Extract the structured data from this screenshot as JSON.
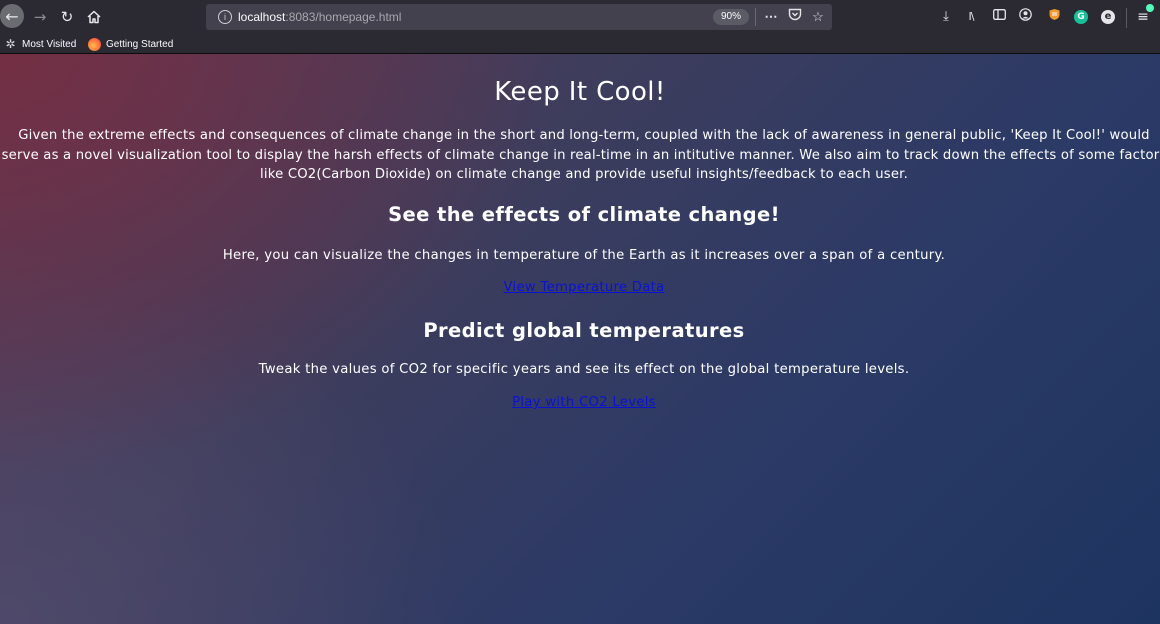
{
  "browser": {
    "url_host": "localhost",
    "url_path": ":8083/homepage.html",
    "zoom": "90%",
    "icons": {
      "back": "arrow-left",
      "forward": "arrow-right",
      "reload": "reload",
      "home": "home",
      "site_info": "info",
      "page_actions": "ellipsis",
      "pocket": "pocket",
      "bookmark": "star",
      "downloads": "download",
      "library": "library",
      "sidebar": "sidebar",
      "account": "account",
      "menu": "hamburger"
    },
    "colors": {
      "toolbar": "#2b2a33",
      "urlbar": "#42414d",
      "update_badge": "#54ffbd"
    }
  },
  "bookmarks": {
    "most_visited": "Most Visited",
    "getting_started": "Getting Started"
  },
  "page": {
    "title": "Keep It Cool!",
    "intro": "Given the extreme effects and consequences of climate change in the short and long-term, coupled with the lack of awareness in general public, 'Keep It Cool!' would serve as a novel visualization tool to display the harsh effects of climate change in real-time in an intitutive manner. We also aim to track down the effects of some factors like CO2(Carbon Dioxide) on climate change and provide useful insights/feedback to each user.",
    "effects": {
      "heading": "See the effects of climate change!",
      "text": "Here, you can visualize the changes in temperature of the Earth as it increases over a span of a century.",
      "link": "View Temperature Data"
    },
    "predict": {
      "heading": "Predict global temperatures",
      "text": "Tweak the values of CO2 for specific years and see its effect on the global temperature levels.",
      "link": "Play with CO2 Levels"
    },
    "colors": {
      "link": "#0a12d6",
      "text": "#ffffff"
    }
  }
}
